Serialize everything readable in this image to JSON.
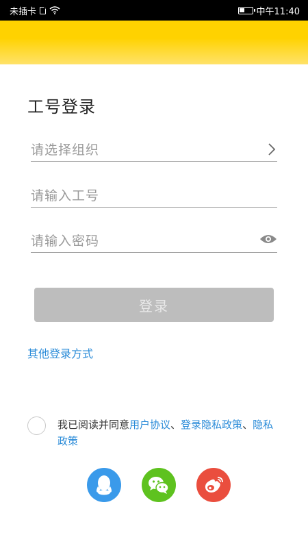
{
  "status_bar": {
    "carrier": "未插卡",
    "time": "中午11:40",
    "icons": [
      "sim-icon",
      "wifi-icon",
      "battery-icon"
    ]
  },
  "header": {
    "color": "#ffd200"
  },
  "page": {
    "title": "工号登录"
  },
  "form": {
    "org_placeholder": "请选择组织",
    "id_placeholder": "请输入工号",
    "password_placeholder": "请输入密码",
    "login_label": "登录"
  },
  "other_login": "其他登录方式",
  "agreement": {
    "prefix": "我已阅读并同意",
    "user_agreement": "用户协议",
    "sep1": "、",
    "login_privacy": "登录隐私政策",
    "sep2": "、",
    "privacy": "隐私政策",
    "checked": false
  },
  "social": [
    "qq-icon",
    "wechat-icon",
    "weibo-icon"
  ],
  "colors": {
    "link": "#2a8bd8",
    "button_disabled": "#bdbdbd",
    "qq": "#3a9aea",
    "wechat": "#5ec21f",
    "weibo": "#ea4e3e"
  }
}
